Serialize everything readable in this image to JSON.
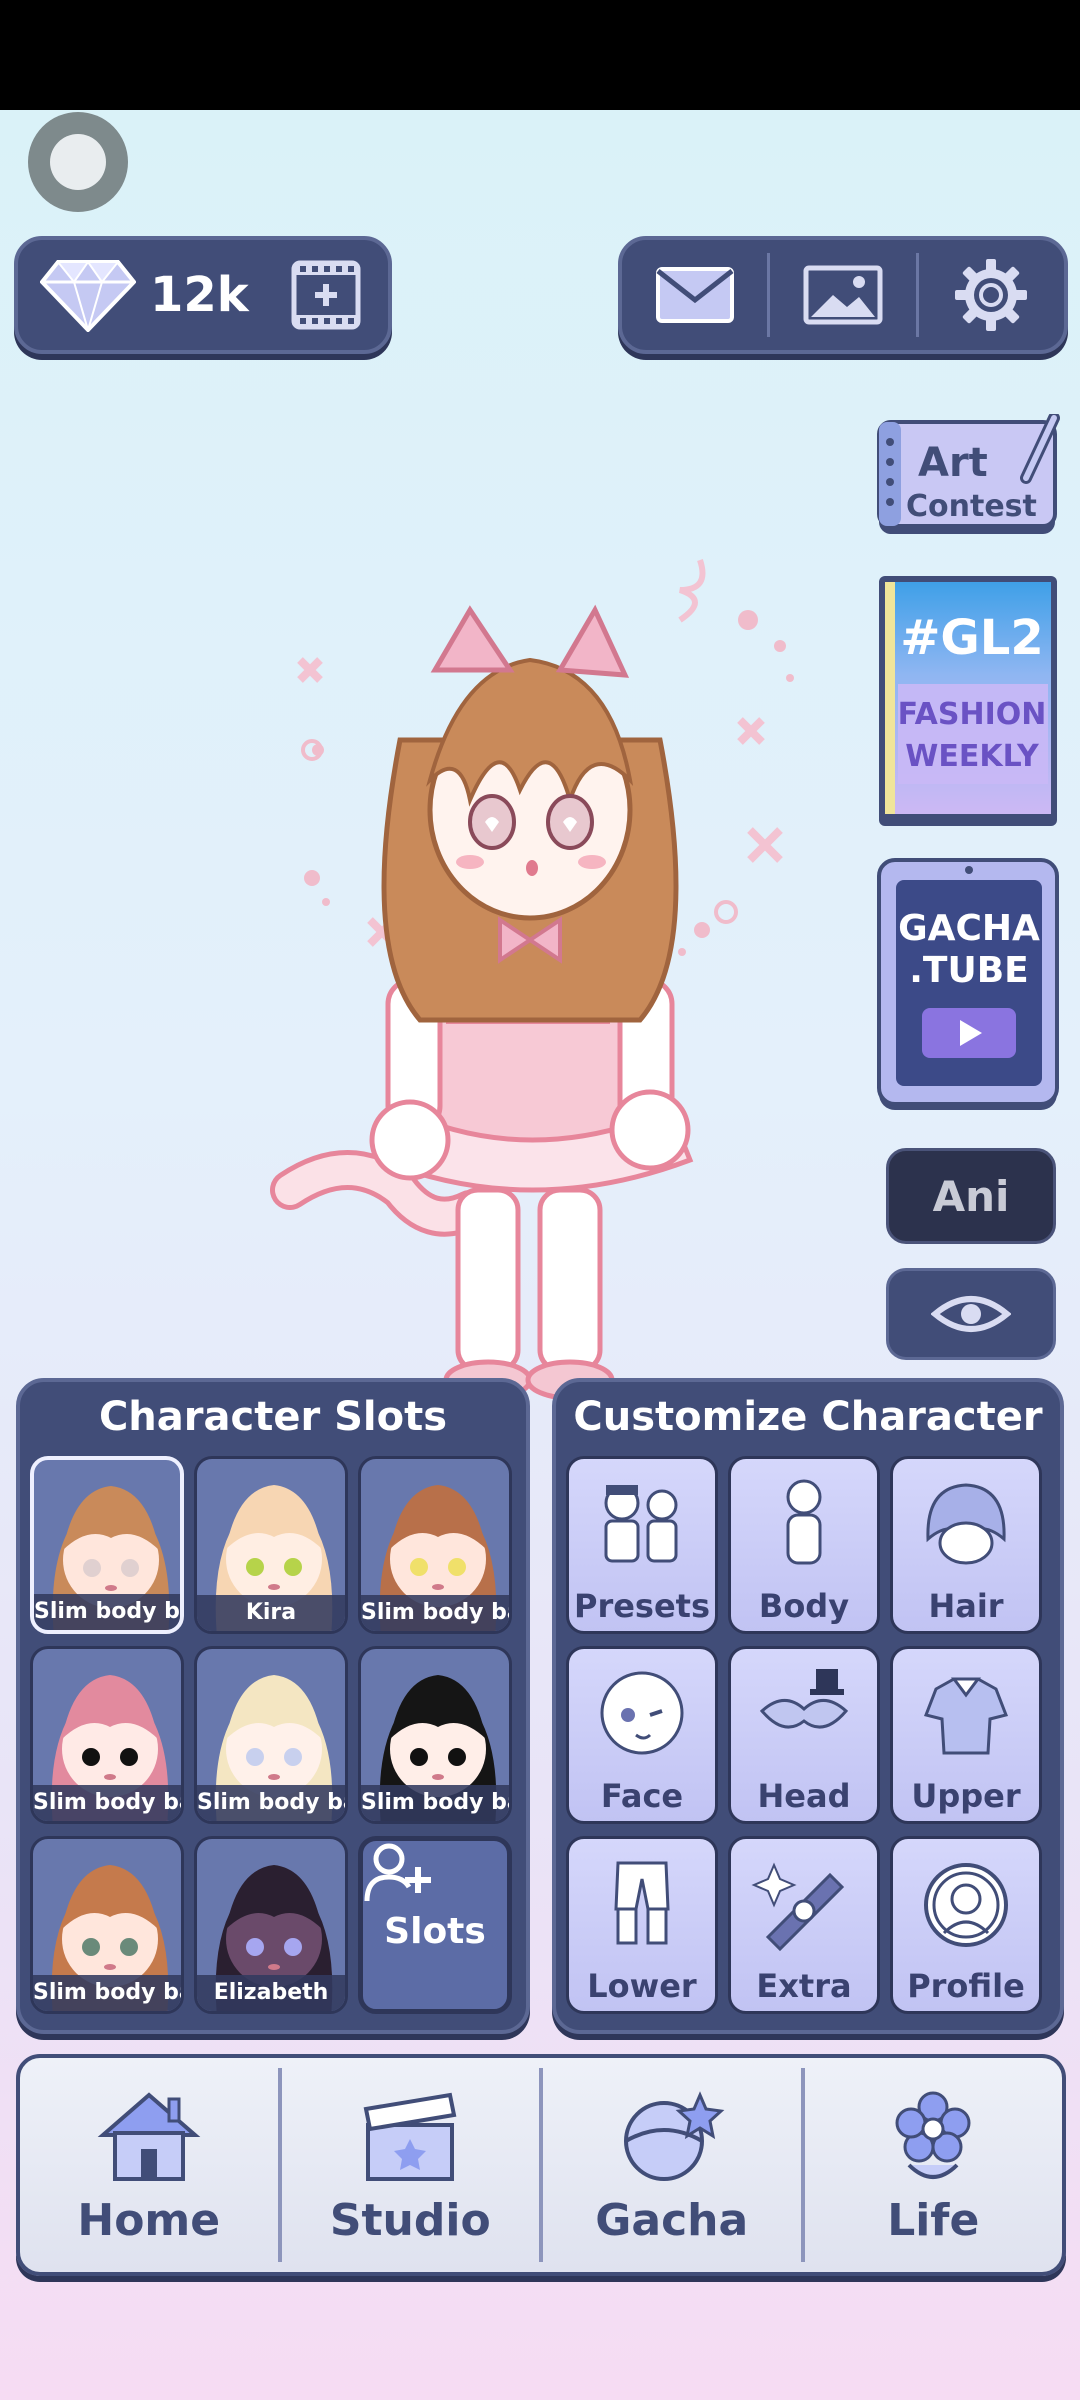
{
  "currency": {
    "value": "12k",
    "icon": "gem-icon"
  },
  "side": {
    "art_contest": {
      "line1": "Art",
      "line2": "Contest"
    },
    "gl2": {
      "tag": "#GL2",
      "line1": "FASHION",
      "line2": "WEEKLY"
    },
    "tube": {
      "line1": "GACHA",
      "line2": ".TUBE"
    },
    "ani": "Ani"
  },
  "slots": {
    "title": "Character Slots",
    "items": [
      {
        "label": "Slim body bas",
        "hair": "#c98a5a",
        "skin": "#ffe6dc",
        "eyes": "#e0d0d0",
        "selected": true
      },
      {
        "label": "Kira",
        "hair": "#f7d6b3",
        "skin": "#ffeee3",
        "eyes": "#b6d34a"
      },
      {
        "label": "Slim body bas",
        "hair": "#b8704a",
        "skin": "#ffe6dc",
        "eyes": "#f0e06a"
      },
      {
        "label": "Slim body bas",
        "hair": "#e28a9e",
        "skin": "#ffeae6",
        "eyes": "#111111"
      },
      {
        "label": "Slim body bas",
        "hair": "#f4e6c2",
        "skin": "#fff1ea",
        "eyes": "#c8d0ee"
      },
      {
        "label": "Slim body bas",
        "hair": "#151515",
        "skin": "#ffeee8",
        "eyes": "#111111"
      },
      {
        "label": "Slim body bas",
        "hair": "#c57a4c",
        "skin": "#ffe6dc",
        "eyes": "#6a8a7a"
      },
      {
        "label": "Elizabeth",
        "hair": "#2a1f30",
        "skin": "#6a4a6a",
        "eyes": "#a6a6f0"
      }
    ],
    "add_label": "Slots"
  },
  "customize": {
    "title": "Customize Character",
    "items": [
      {
        "label": "Presets",
        "icon": "presets-icon"
      },
      {
        "label": "Body",
        "icon": "body-icon"
      },
      {
        "label": "Hair",
        "icon": "hair-icon"
      },
      {
        "label": "Face",
        "icon": "face-icon"
      },
      {
        "label": "Head",
        "icon": "head-icon"
      },
      {
        "label": "Upper",
        "icon": "upper-icon"
      },
      {
        "label": "Lower",
        "icon": "lower-icon"
      },
      {
        "label": "Extra",
        "icon": "extra-icon"
      },
      {
        "label": "Profile",
        "icon": "profile-icon"
      }
    ]
  },
  "nav": [
    {
      "label": "Home",
      "icon": "house-icon"
    },
    {
      "label": "Studio",
      "icon": "clapperboard-icon"
    },
    {
      "label": "Gacha",
      "icon": "gacha-orb-icon"
    },
    {
      "label": "Life",
      "icon": "flower-icon"
    }
  ],
  "colors": {
    "panel": "#414d78",
    "panel_border": "#5c6894",
    "tile": "#c9cbf6",
    "accent_pink": "#f2b5c8"
  }
}
